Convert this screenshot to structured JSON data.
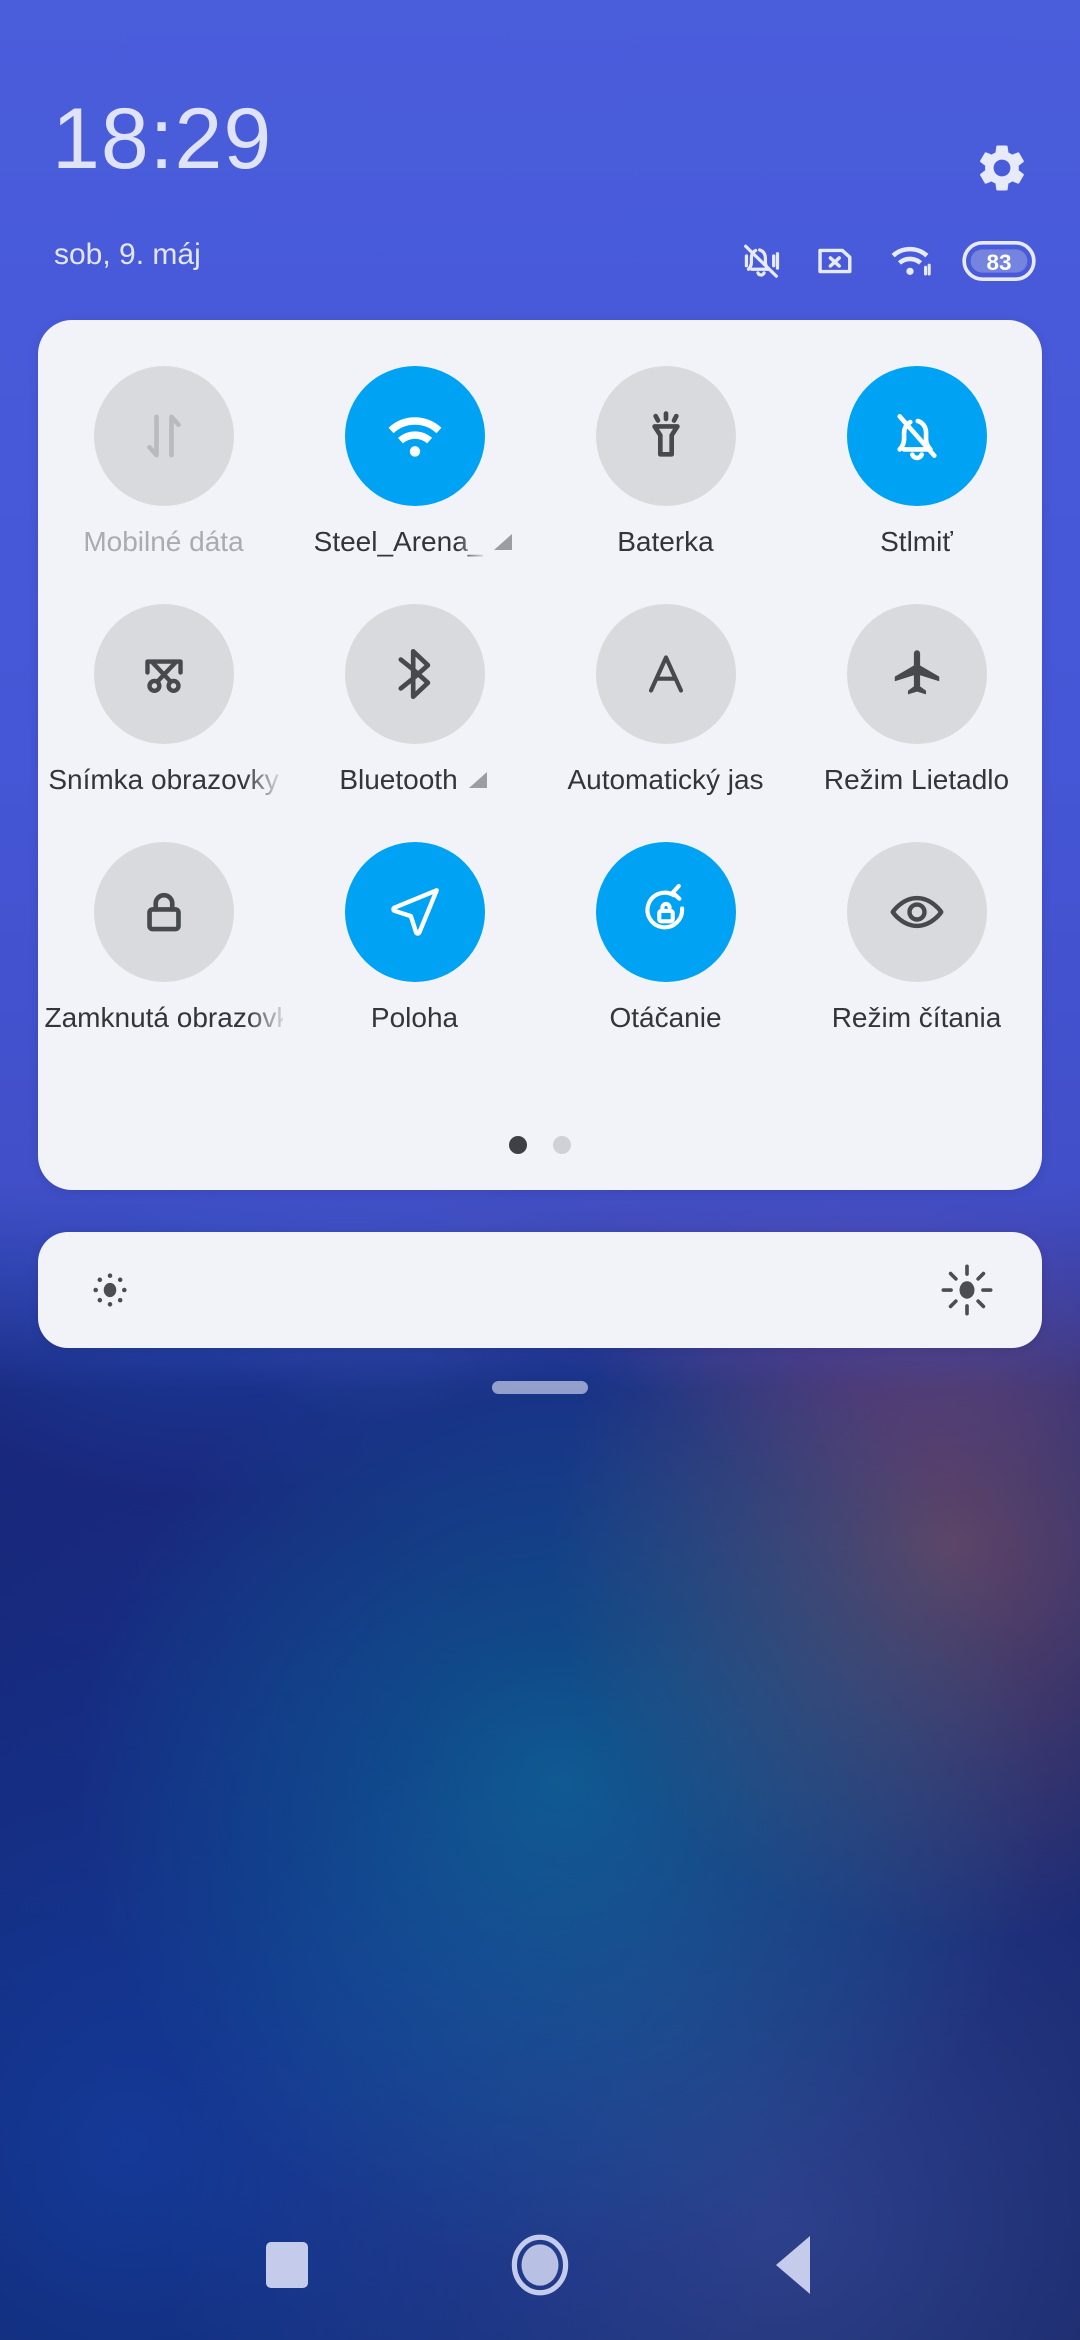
{
  "status_bar": {
    "clock": "18:29",
    "date": "sob, 9. máj",
    "battery_percent": "83",
    "icons": [
      {
        "name": "vibrate-off-icon",
        "label": "Tiché vyzváňanie"
      },
      {
        "name": "sim-card-error-icon",
        "label": "Žiadna SIM karta"
      },
      {
        "name": "wifi-icon",
        "label": "Wi-Fi pripojené"
      },
      {
        "name": "battery-icon",
        "label": "83"
      }
    ],
    "settings_button_label": "Nastavenia"
  },
  "quick_settings": {
    "tiles": [
      {
        "label": "Mobilné dáta",
        "icon": "mobile-data-icon",
        "state": "off",
        "dim_label": true,
        "expandable": false,
        "truncated": false
      },
      {
        "label": "Steel_Arena_",
        "icon": "wifi-icon",
        "state": "on",
        "dim_label": false,
        "expandable": true,
        "truncated": true
      },
      {
        "label": "Baterka",
        "icon": "flashlight-icon",
        "state": "off",
        "dim_label": false,
        "expandable": false,
        "truncated": false
      },
      {
        "label": "Stlmiť",
        "icon": "bell-off-icon",
        "state": "on",
        "dim_label": false,
        "expandable": false,
        "truncated": false
      },
      {
        "label": "Snímka obrazovky",
        "icon": "screenshot-icon",
        "state": "off",
        "dim_label": false,
        "expandable": false,
        "truncated": true
      },
      {
        "label": "Bluetooth",
        "icon": "bluetooth-icon",
        "state": "off",
        "dim_label": false,
        "expandable": true,
        "truncated": false
      },
      {
        "label": "Automatický jas",
        "icon": "auto-brightness-icon",
        "state": "off",
        "dim_label": false,
        "expandable": false,
        "truncated": false
      },
      {
        "label": "Režim Lietadlo",
        "icon": "airplane-icon",
        "state": "off",
        "dim_label": false,
        "expandable": false,
        "truncated": false
      },
      {
        "label": "Zamknutá obrazovka",
        "icon": "lock-icon",
        "state": "off",
        "dim_label": false,
        "expandable": false,
        "truncated": true
      },
      {
        "label": "Poloha",
        "icon": "location-icon",
        "state": "on",
        "dim_label": false,
        "expandable": false,
        "truncated": false
      },
      {
        "label": "Otáčanie",
        "icon": "rotation-icon",
        "state": "on",
        "dim_label": false,
        "expandable": false,
        "truncated": false
      },
      {
        "label": "Režim čítania",
        "icon": "eye-icon",
        "state": "off",
        "dim_label": false,
        "expandable": false,
        "truncated": false
      }
    ],
    "pages": {
      "count": 2,
      "active_index": 0
    }
  },
  "brightness": {
    "low_icon": "brightness-low-icon",
    "high_icon": "brightness-high-icon",
    "level_percent": 0,
    "label": "Jas"
  },
  "drag_handle": {
    "name": "panel-drag-handle"
  },
  "nav_bar": {
    "buttons": [
      {
        "name": "nav-recents-button",
        "label": "Nedávne"
      },
      {
        "name": "nav-home-button",
        "label": "Domov"
      },
      {
        "name": "nav-back-button",
        "label": "Späť"
      }
    ]
  },
  "colors": {
    "accent_on": "#00a2f3",
    "tile_off": "#d9dadd",
    "card_bg": "#f1f3f9",
    "header_blue": "#4a5ddb",
    "text_dark": "#333538",
    "text_dim": "#a9abb0"
  }
}
